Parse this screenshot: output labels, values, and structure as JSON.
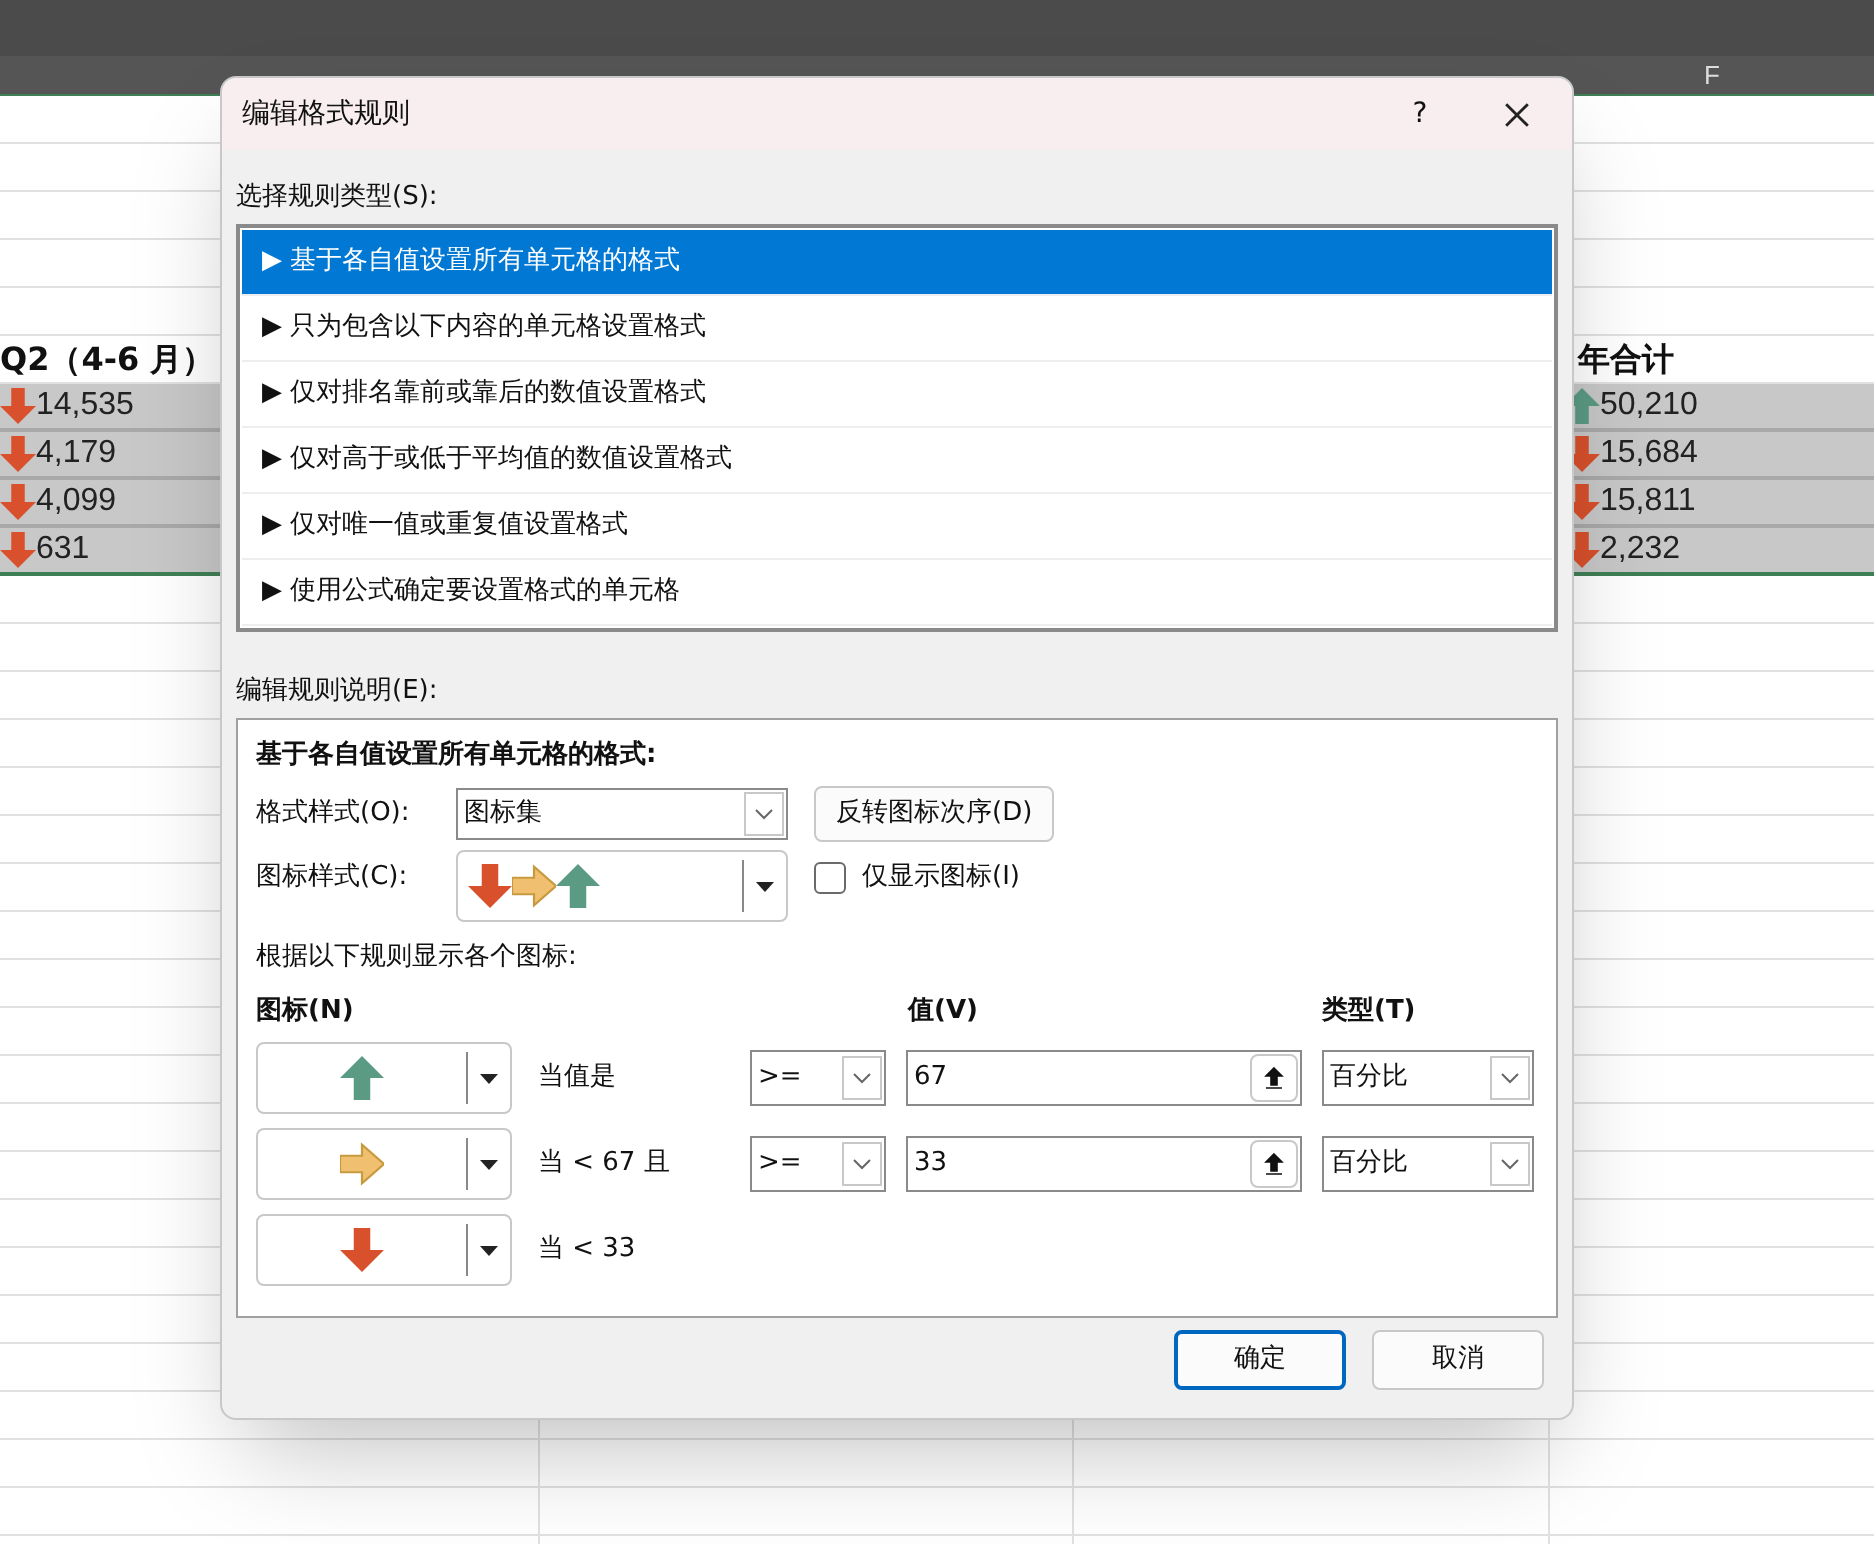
{
  "sheet": {
    "column_header": "F",
    "header_row": {
      "left": "Q2（4-6 月）",
      "right": "年合计"
    },
    "rows": [
      {
        "left": {
          "value": "14,535",
          "kind": "down"
        },
        "right": {
          "value": "50,210",
          "kind": "up"
        }
      },
      {
        "left": {
          "value": "4,179",
          "kind": "down"
        },
        "right": {
          "value": "15,684",
          "kind": "down"
        }
      },
      {
        "left": {
          "value": "4,099",
          "kind": "down"
        },
        "right": {
          "value": "15,811",
          "kind": "down"
        }
      },
      {
        "left": {
          "value": "631",
          "kind": "down"
        },
        "right": {
          "value": "2,232",
          "kind": "down"
        }
      }
    ]
  },
  "dialog": {
    "title": "编辑格式规则",
    "help": "?",
    "rule_type_label": "选择规则类型(S):",
    "rule_types": [
      {
        "label": "▶ 基于各自值设置所有单元格的格式",
        "selected": true
      },
      {
        "label": "▶ 只为包含以下内容的单元格设置格式",
        "selected": false
      },
      {
        "label": "▶ 仅对排名靠前或靠后的数值设置格式",
        "selected": false
      },
      {
        "label": "▶ 仅对高于或低于平均值的数值设置格式",
        "selected": false
      },
      {
        "label": "▶ 仅对唯一值或重复值设置格式",
        "selected": false
      },
      {
        "label": "▶ 使用公式确定要设置格式的单元格",
        "selected": false
      }
    ],
    "description_label": "编辑规则说明(E):",
    "description": {
      "heading": "基于各自值设置所有单元格的格式:",
      "format_style_label": "格式样式(O):",
      "format_style": "图标集",
      "reverse_button": "反转图标次序(D)",
      "icon_style_label": "图标样式(C):",
      "icon_style": [
        {
          "kind": "down"
        },
        {
          "kind": "right"
        },
        {
          "kind": "up"
        }
      ],
      "show_icon_only": {
        "label": "仅显示图标(I)",
        "checked": false
      },
      "rules_label": "根据以下规则显示各个图标:",
      "columns": {
        "icon": "图标(N)",
        "value": "值(V)",
        "type": "类型(T)"
      },
      "rules": [
        {
          "kind": "up",
          "condition": "当值是",
          "operator": ">=",
          "value": "67",
          "type": "百分比"
        },
        {
          "kind": "right",
          "condition": "当 < 67 且",
          "operator": ">=",
          "value": "33",
          "type": "百分比"
        },
        {
          "kind": "down",
          "condition": "当 < 33"
        }
      ]
    },
    "buttons": [
      {
        "label": "确定",
        "default": true
      },
      {
        "label": "取消",
        "default": false
      }
    ]
  }
}
